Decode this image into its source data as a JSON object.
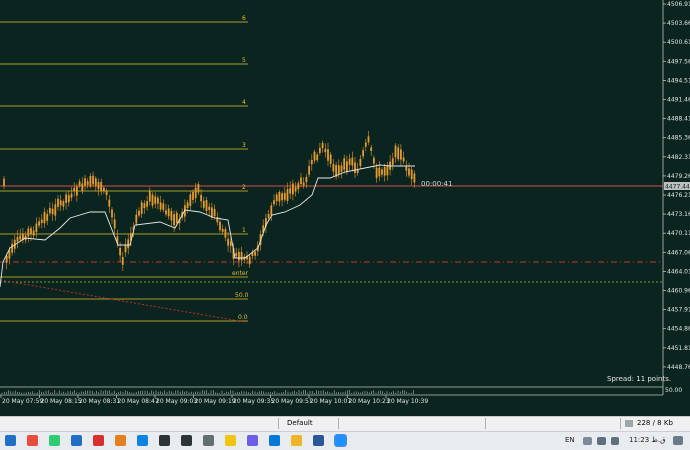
{
  "chart": {
    "symbol_price": "4477.44",
    "countdown": "00:00:41",
    "spread": "Spread: 11 points.",
    "axis_bottom_value": "50.00",
    "fib_labels": [
      "6",
      "5",
      "4",
      "3",
      "2",
      "1",
      "enter",
      "50.0",
      "0.0"
    ],
    "price_ticks": [
      "4506.91",
      "4503.66",
      "4500.61",
      "4497.56",
      "4494.51",
      "4491.46",
      "4488.41",
      "4485.36",
      "4482.31",
      "4479.26",
      "4476.21",
      "4473.16",
      "4470.11",
      "4467.06",
      "4464.01",
      "4460.96",
      "4457.91",
      "4454.86",
      "4451.81",
      "4448.76"
    ],
    "time_ticks": [
      "20 May 07:59",
      "20 May 08:15",
      "20 May 08:31",
      "20 May 08:47",
      "20 May 09:03",
      "20 May 09:19",
      "20 May 09:35",
      "20 May 09:51",
      "20 May 10:07",
      "20 May 10:23",
      "20 May 10:39"
    ],
    "colors": {
      "background": "#0a241f",
      "candle": "#e69b2e",
      "fib_line": "#e6c02e",
      "bid_line": "#d94c4c",
      "dashed_level": "#c83232",
      "ma_line": "#e8e8e8"
    }
  },
  "tabbar": {
    "tab_label": "Default",
    "traffic": "228 / 8 Kb"
  },
  "taskbar": {
    "language": "EN",
    "time": "11:23 ق.ظ",
    "icons": [
      "start-icon",
      "chrome-icon",
      "chrome-icon-2",
      "mail-icon",
      "youtube-icon",
      "firefox-icon",
      "files-icon",
      "fn-app-icon",
      "fn-app-icon-2",
      "settings-app-icon",
      "yellow-app-icon",
      "photos-app-icon",
      "edge-icon",
      "folder-icon",
      "word-icon",
      "metatrader-icon"
    ]
  }
}
